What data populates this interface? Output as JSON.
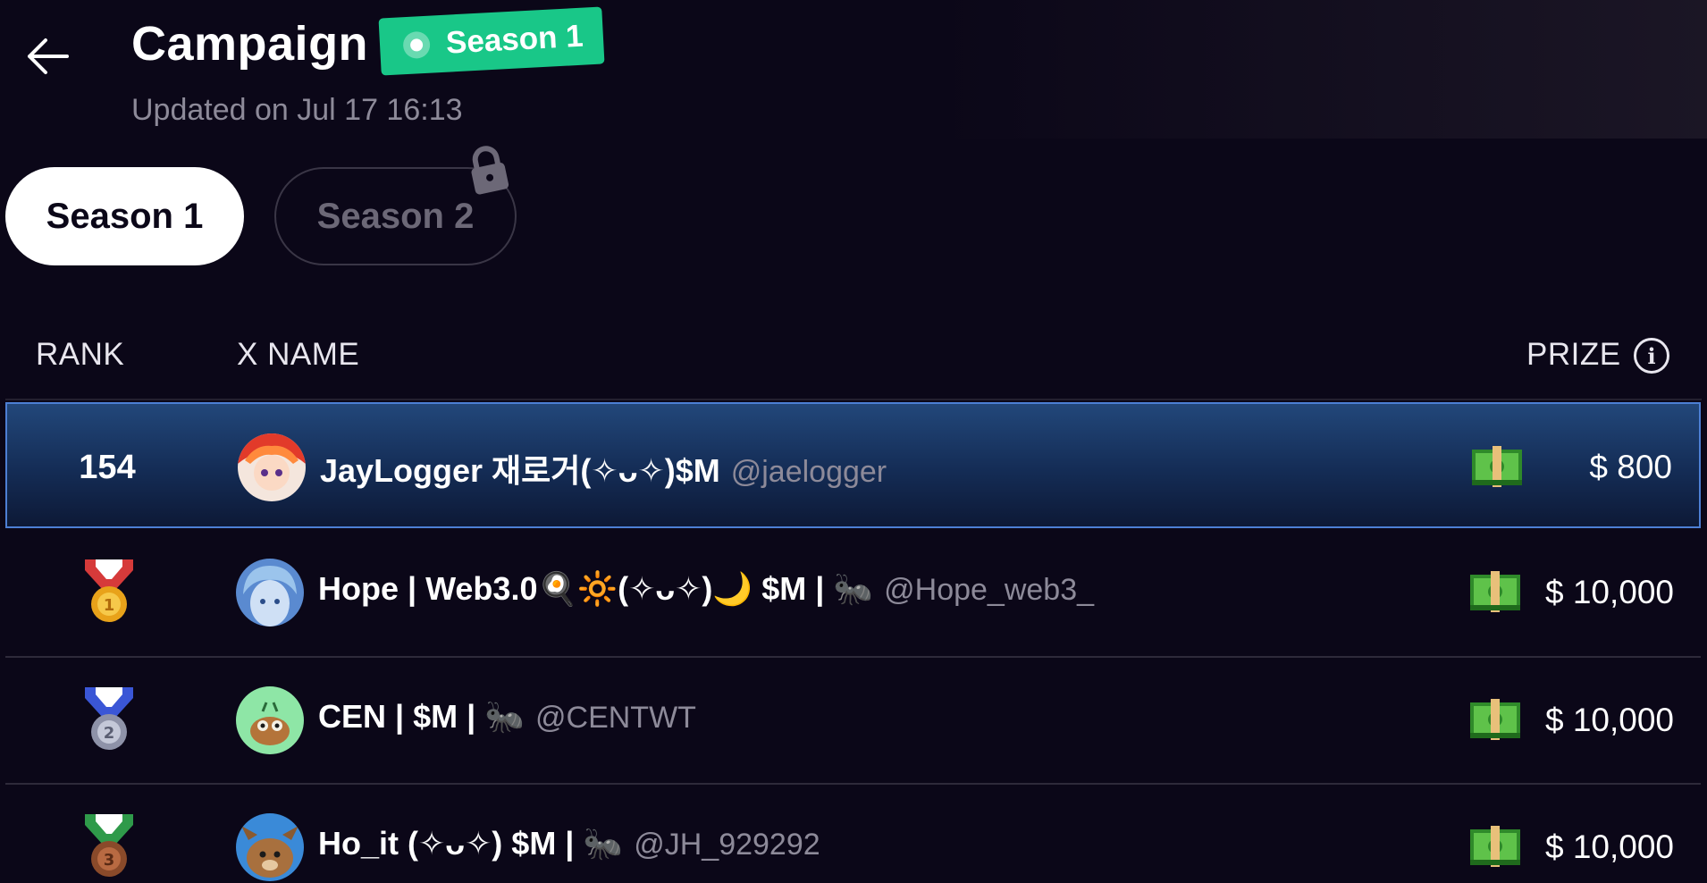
{
  "header": {
    "title": "Campaign",
    "badge": "Season 1",
    "updated": "Updated on Jul 17 16:13"
  },
  "tabs": [
    {
      "label": "Season 1",
      "state": "active"
    },
    {
      "label": "Season 2",
      "state": "locked"
    }
  ],
  "columns": {
    "rank": "RANK",
    "name": "X NAME",
    "prize": "PRIZE"
  },
  "rows": [
    {
      "rank": "154",
      "medal": null,
      "name": "JayLogger 재로거(✧ᴗ✧)$M",
      "handle": "@jaelogger",
      "prize": "$ 800",
      "highlight": true
    },
    {
      "rank": "1",
      "medal": "gold-medal-icon",
      "name": "Hope |  Web3.0🍳🔆(✧ᴗ✧)🌙 $M | 🐜",
      "handle": "@Hope_web3_",
      "prize": "$ 10,000",
      "highlight": false
    },
    {
      "rank": "2",
      "medal": "silver-medal-icon",
      "name": "CEN | $M | 🐜",
      "handle": "@CENTWT",
      "prize": "$ 10,000",
      "highlight": false
    },
    {
      "rank": "3",
      "medal": "bronze-medal-icon",
      "name": "Ho_it (✧ᴗ✧) $M | 🐜",
      "handle": "@JH_929292",
      "prize": "$ 10,000",
      "highlight": false
    }
  ],
  "colors": {
    "background": "#0b0718",
    "badge": "#19c788",
    "highlight_border": "#4d7fd4"
  }
}
